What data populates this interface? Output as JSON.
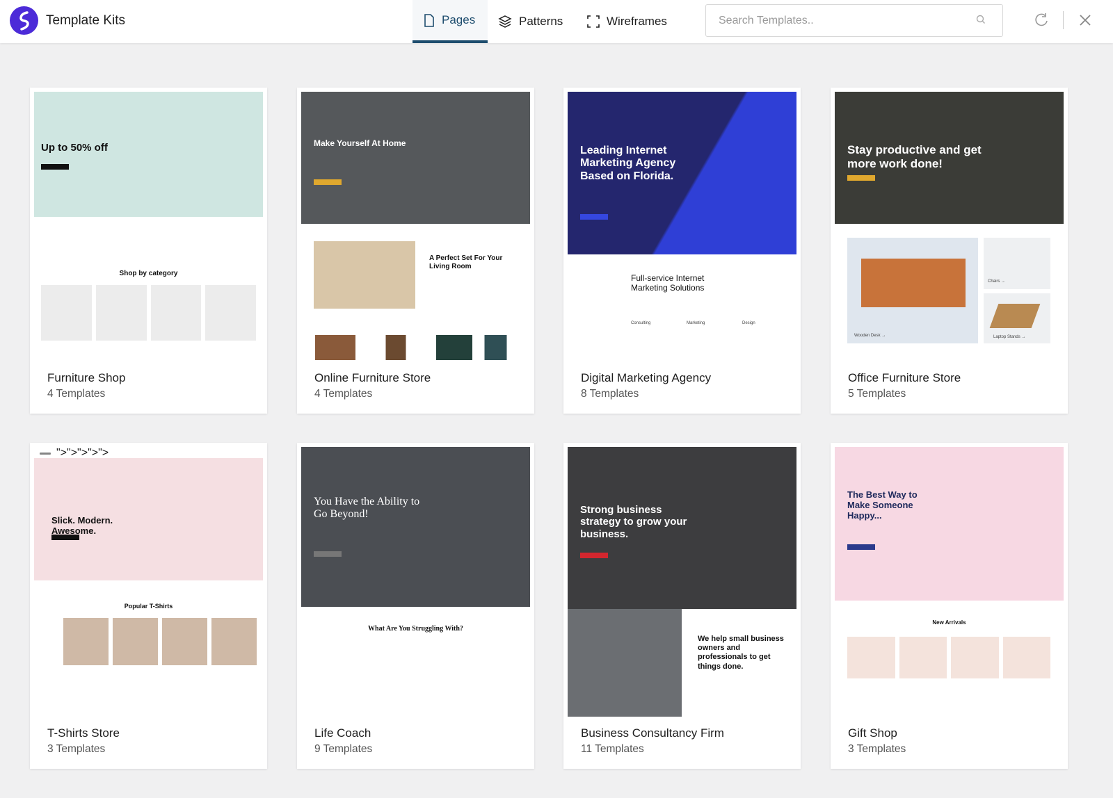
{
  "header": {
    "app_title": "Template Kits",
    "tabs": [
      {
        "label": "Pages",
        "icon": "page-icon",
        "active": true
      },
      {
        "label": "Patterns",
        "icon": "layers-icon",
        "active": false
      },
      {
        "label": "Wireframes",
        "icon": "frame-icon",
        "active": false
      }
    ],
    "search": {
      "placeholder": "Search Templates..",
      "value": ""
    },
    "accent": "#1e4d6e",
    "logo_color": "#4c2bd8"
  },
  "kits": [
    {
      "title": "Furniture Shop",
      "count": "4 Templates",
      "preview": {
        "hero_color": "#cfe6e1",
        "hero_text_color": "#111111",
        "headline": "Up to 50% off",
        "lower_title": "Shop by category",
        "labels": []
      }
    },
    {
      "title": "Online Furniture Store",
      "count": "4 Templates",
      "preview": {
        "hero_color": "#55585b",
        "hero_text_color": "#ffffff",
        "headline": "Make Yourself At Home",
        "lower_title": "A Perfect Set For Your Living Room",
        "labels": []
      }
    },
    {
      "title": "Digital Marketing Agency",
      "count": "8 Templates",
      "preview": {
        "hero_color": "#272a7e",
        "hero_text_color": "#ffffff",
        "headline": "Leading Internet Marketing Agency Based on Florida.",
        "lower_title": "Full-service Internet Marketing Solutions",
        "labels": [
          "Consulting",
          "Marketing",
          "Design"
        ]
      }
    },
    {
      "title": "Office Furniture Store",
      "count": "5 Templates",
      "preview": {
        "hero_color": "#3b3c37",
        "hero_text_color": "#ffffff",
        "headline": "Stay productive and get more work done!",
        "lower_title": "",
        "labels": [
          "Chairs →",
          "Wooden Desk →",
          "Laptop Stands →"
        ]
      }
    },
    {
      "title": "T-Shirts Store",
      "count": "3 Templates",
      "preview": {
        "hero_color": "#f5dfe2",
        "hero_text_color": "#111111",
        "headline": "Slick. Modern. Awesome.",
        "lower_title": "Popular T-Shirts",
        "labels": []
      }
    },
    {
      "title": "Life Coach",
      "count": "9 Templates",
      "preview": {
        "hero_color": "#4b4e53",
        "hero_text_color": "#ffffff",
        "headline": "You Have the Ability to Go Beyond!",
        "lower_title": "What Are You Struggling With?",
        "labels": []
      }
    },
    {
      "title": "Business Consultancy Firm",
      "count": "11 Templates",
      "preview": {
        "hero_color": "#3d3d3f",
        "hero_text_color": "#ffffff",
        "headline": "Strong business strategy to grow your business.",
        "lower_title": "We help small business owners and professionals to get things done.",
        "labels": []
      }
    },
    {
      "title": "Gift Shop",
      "count": "3 Templates",
      "preview": {
        "hero_color": "#f7d8e3",
        "hero_text_color": "#1f2a5c",
        "headline": "The Best Way to Make Someone Happy...",
        "lower_title": "New Arrivals",
        "labels": []
      }
    }
  ]
}
